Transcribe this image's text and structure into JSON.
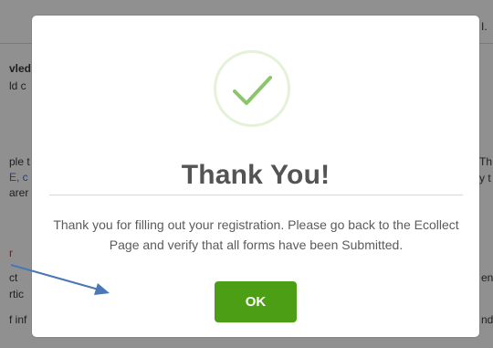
{
  "background": {
    "left_fragments": [
      "vled",
      "ld c",
      "ple t",
      "E, c",
      "arer",
      "r",
      "ct",
      "rtic",
      "f inf"
    ],
    "right_fragments": [
      "I.",
      "Th",
      "y t",
      "en",
      "nd"
    ]
  },
  "modal": {
    "icon": "checkmark-icon",
    "title": "Thank You!",
    "message": "Thank you for filling out your registration. Please go back to the Ecollect Page and verify that all forms have been Submitted.",
    "ok_label": "OK"
  },
  "colors": {
    "ok_button": "#4c9e14",
    "check": "#8cc56a",
    "check_ring": "#e4f2d8",
    "arrow": "#4a77b5"
  }
}
